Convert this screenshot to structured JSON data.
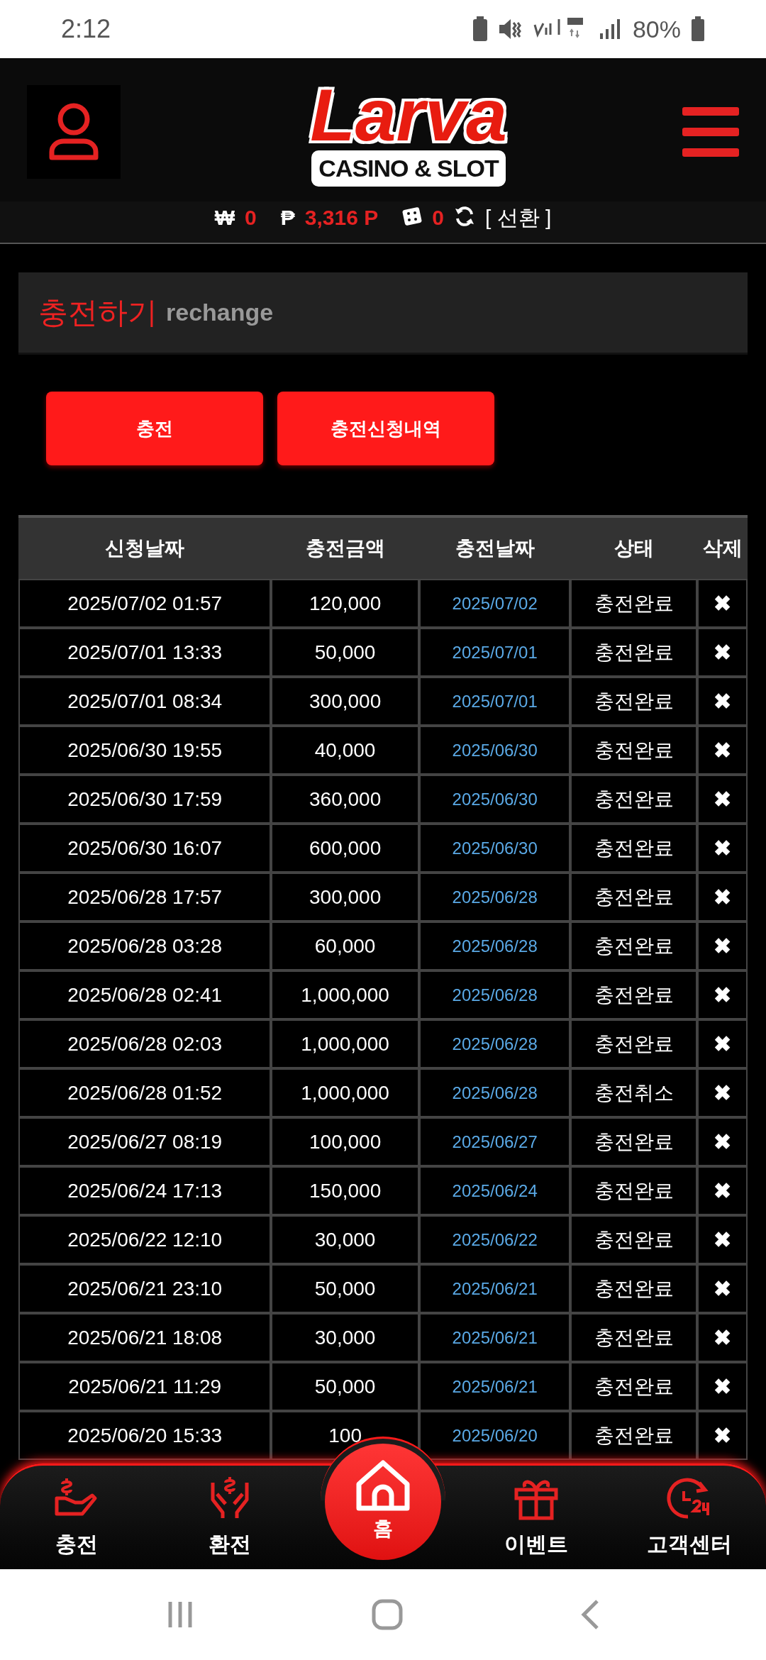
{
  "status_bar": {
    "time": "2:12",
    "battery": "80%"
  },
  "header": {
    "logo_title": "Larva",
    "logo_subtitle": "CASINO & SLOT"
  },
  "balance": {
    "won_symbol": "₩",
    "peso_symbol": "₱",
    "won": "0",
    "points": "3,316 P",
    "chips": "0",
    "switch": "[ 선환 ]"
  },
  "section": {
    "title": "충전하기",
    "subtitle": "rechange"
  },
  "buttons": [
    "충전",
    "충전신청내역"
  ],
  "table": {
    "columns": [
      "신청날짜",
      "충전금액",
      "충전날짜",
      "상태",
      "삭제"
    ],
    "rows": [
      [
        "2025/07/02 01:57",
        "120,000",
        "2025/07/02",
        "충전완료",
        "✖"
      ],
      [
        "2025/07/01 13:33",
        "50,000",
        "2025/07/01",
        "충전완료",
        "✖"
      ],
      [
        "2025/07/01 08:34",
        "300,000",
        "2025/07/01",
        "충전완료",
        "✖"
      ],
      [
        "2025/06/30 19:55",
        "40,000",
        "2025/06/30",
        "충전완료",
        "✖"
      ],
      [
        "2025/06/30 17:59",
        "360,000",
        "2025/06/30",
        "충전완료",
        "✖"
      ],
      [
        "2025/06/30 16:07",
        "600,000",
        "2025/06/30",
        "충전완료",
        "✖"
      ],
      [
        "2025/06/28 17:57",
        "300,000",
        "2025/06/28",
        "충전완료",
        "✖"
      ],
      [
        "2025/06/28 03:28",
        "60,000",
        "2025/06/28",
        "충전완료",
        "✖"
      ],
      [
        "2025/06/28 02:41",
        "1,000,000",
        "2025/06/28",
        "충전완료",
        "✖"
      ],
      [
        "2025/06/28 02:03",
        "1,000,000",
        "2025/06/28",
        "충전완료",
        "✖"
      ],
      [
        "2025/06/28 01:52",
        "1,000,000",
        "2025/06/28",
        "충전취소",
        "✖"
      ],
      [
        "2025/06/27 08:19",
        "100,000",
        "2025/06/27",
        "충전완료",
        "✖"
      ],
      [
        "2025/06/24 17:13",
        "150,000",
        "2025/06/24",
        "충전완료",
        "✖"
      ],
      [
        "2025/06/22 12:10",
        "30,000",
        "2025/06/22",
        "충전완료",
        "✖"
      ],
      [
        "2025/06/21 23:10",
        "50,000",
        "2025/06/21",
        "충전완료",
        "✖"
      ],
      [
        "2025/06/21 18:08",
        "30,000",
        "2025/06/21",
        "충전완료",
        "✖"
      ],
      [
        "2025/06/21 11:29",
        "50,000",
        "2025/06/21",
        "충전완료",
        "✖"
      ],
      [
        "2025/06/20 15:33",
        "100",
        "2025/06/20",
        "충전완료",
        "✖"
      ]
    ]
  },
  "bottom_nav": [
    {
      "label": "충전",
      "kind": "charge",
      "selected": false
    },
    {
      "label": "환전",
      "kind": "exchange",
      "selected": false
    },
    {
      "label": "홈",
      "kind": "home",
      "selected": true
    },
    {
      "label": "이벤트",
      "kind": "event",
      "selected": false
    },
    {
      "label": "고객센터",
      "kind": "support",
      "selected": false
    }
  ]
}
